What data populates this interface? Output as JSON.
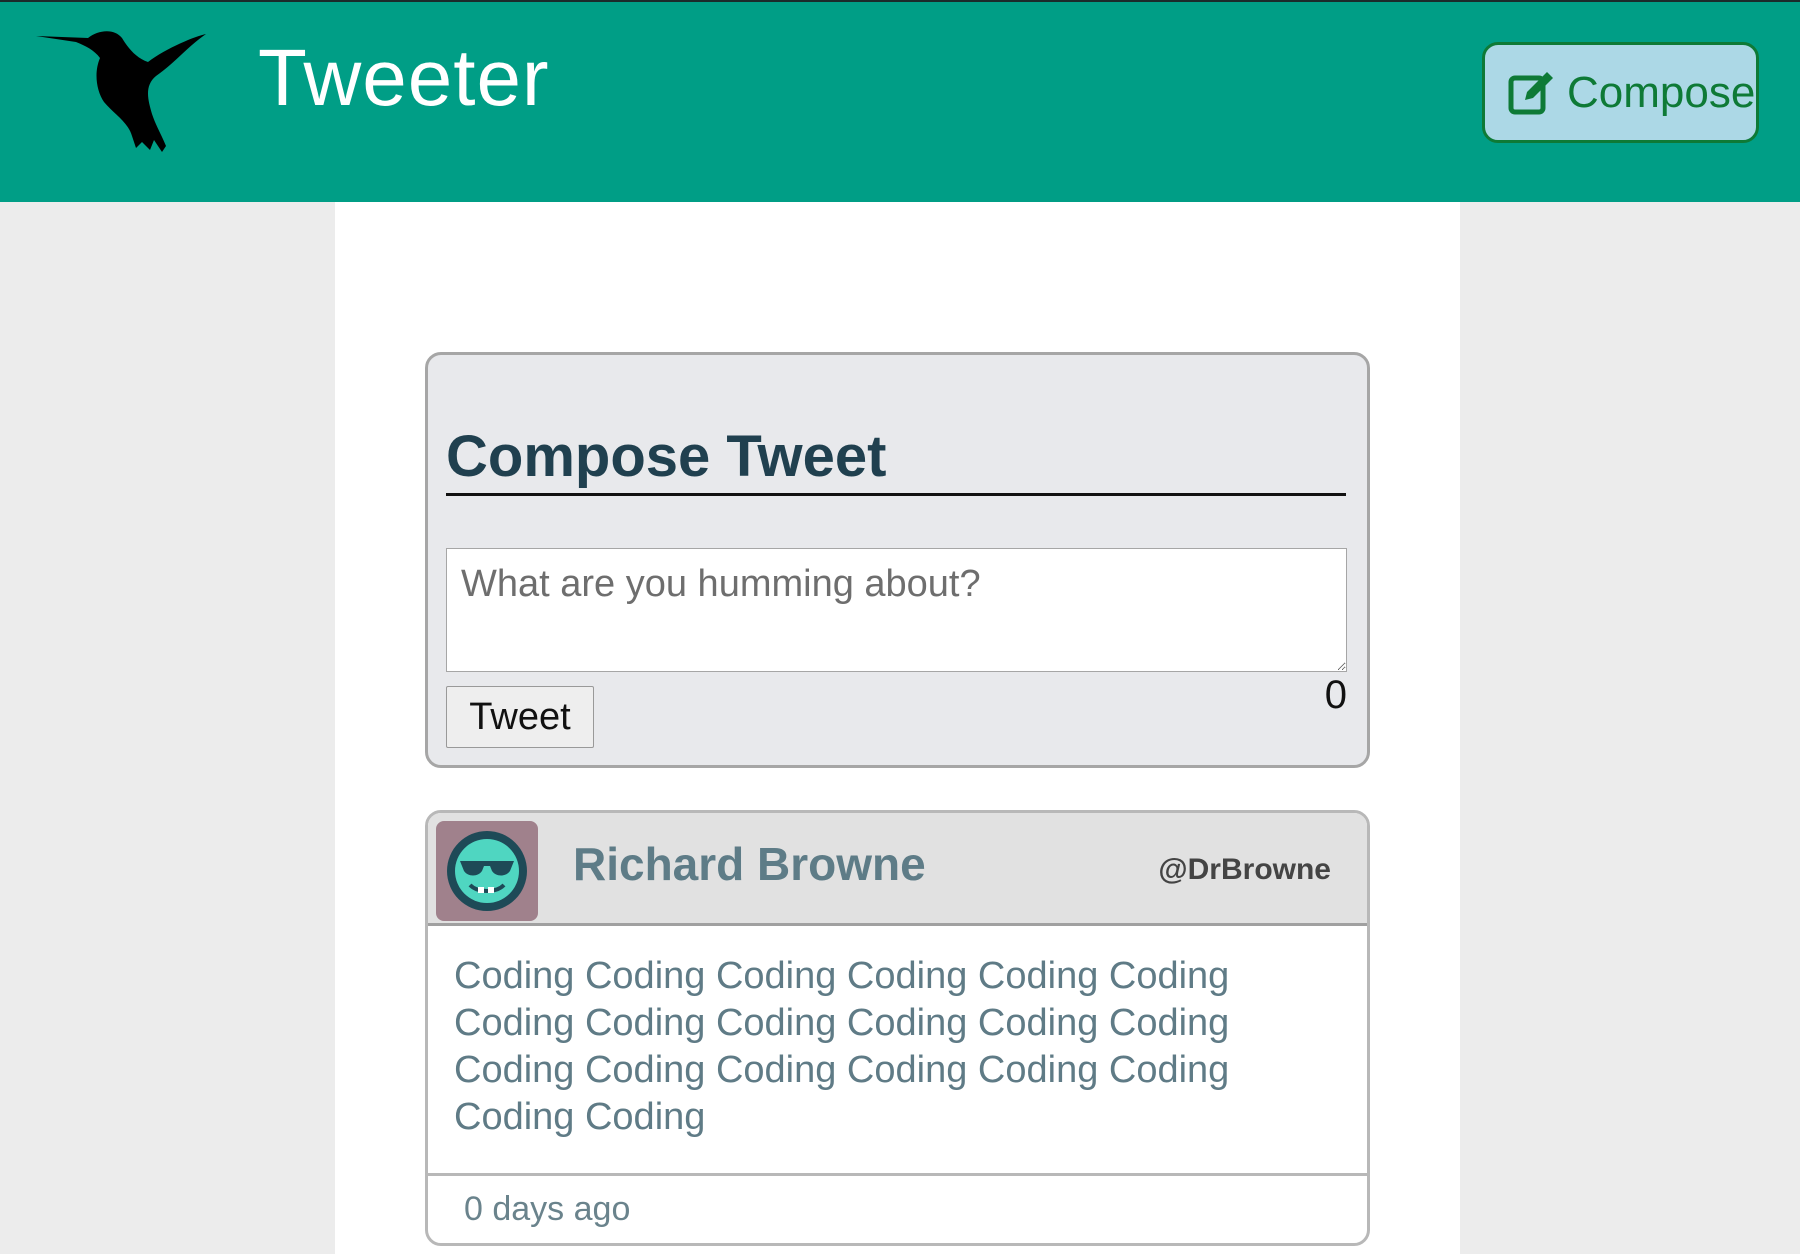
{
  "header": {
    "brand": "Tweeter",
    "compose_label": "Compose"
  },
  "compose": {
    "title": "Compose Tweet",
    "placeholder": "What are you humming about?",
    "button_label": "Tweet",
    "counter": "0"
  },
  "tweets": [
    {
      "name": "Richard Browne",
      "handle": "@DrBrowne",
      "text": "Coding Coding Coding Coding Coding Coding Coding Coding Coding Coding Coding Coding Coding Coding Coding Coding Coding Coding Coding Coding",
      "time": "0 days ago"
    }
  ],
  "icons": {
    "logo": "hummingbird-icon",
    "compose": "edit-icon",
    "avatar": "avatar-icon"
  },
  "colors": {
    "header_bg": "#009e86",
    "compose_btn_bg": "#acd8e6",
    "compose_btn_fg": "#0e7a36",
    "card_bg": "#e8e9ec",
    "name_color": "#5e7c87"
  }
}
